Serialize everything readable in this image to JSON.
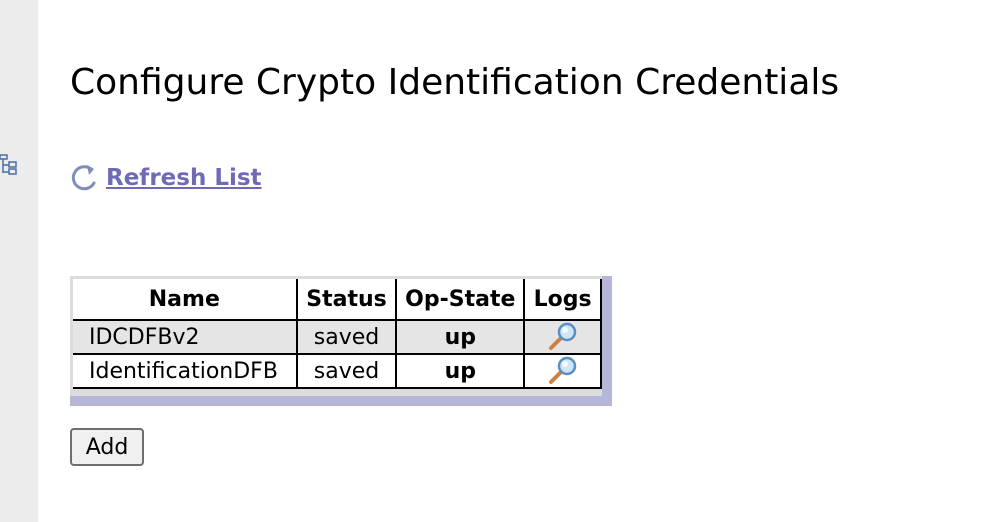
{
  "page": {
    "title": "Configure Crypto Identification Credentials"
  },
  "refresh": {
    "label": "Refresh List",
    "icon": "refresh-icon"
  },
  "sidebar": {
    "icon": "tree-icon"
  },
  "table": {
    "headers": [
      "Name",
      "Status",
      "Op-State",
      "Logs"
    ],
    "rows": [
      {
        "name": "IDCDFBv2",
        "status": "saved",
        "op_state": "up",
        "logs_icon": "magnifier-icon"
      },
      {
        "name": "IdentificationDFB",
        "status": "saved",
        "op_state": "up",
        "logs_icon": "magnifier-icon"
      }
    ]
  },
  "actions": {
    "add_label": "Add"
  },
  "colors": {
    "link": "#6e6ab5",
    "table_shadow": "#b5b6d8",
    "sidebar_bg": "#ececec"
  }
}
